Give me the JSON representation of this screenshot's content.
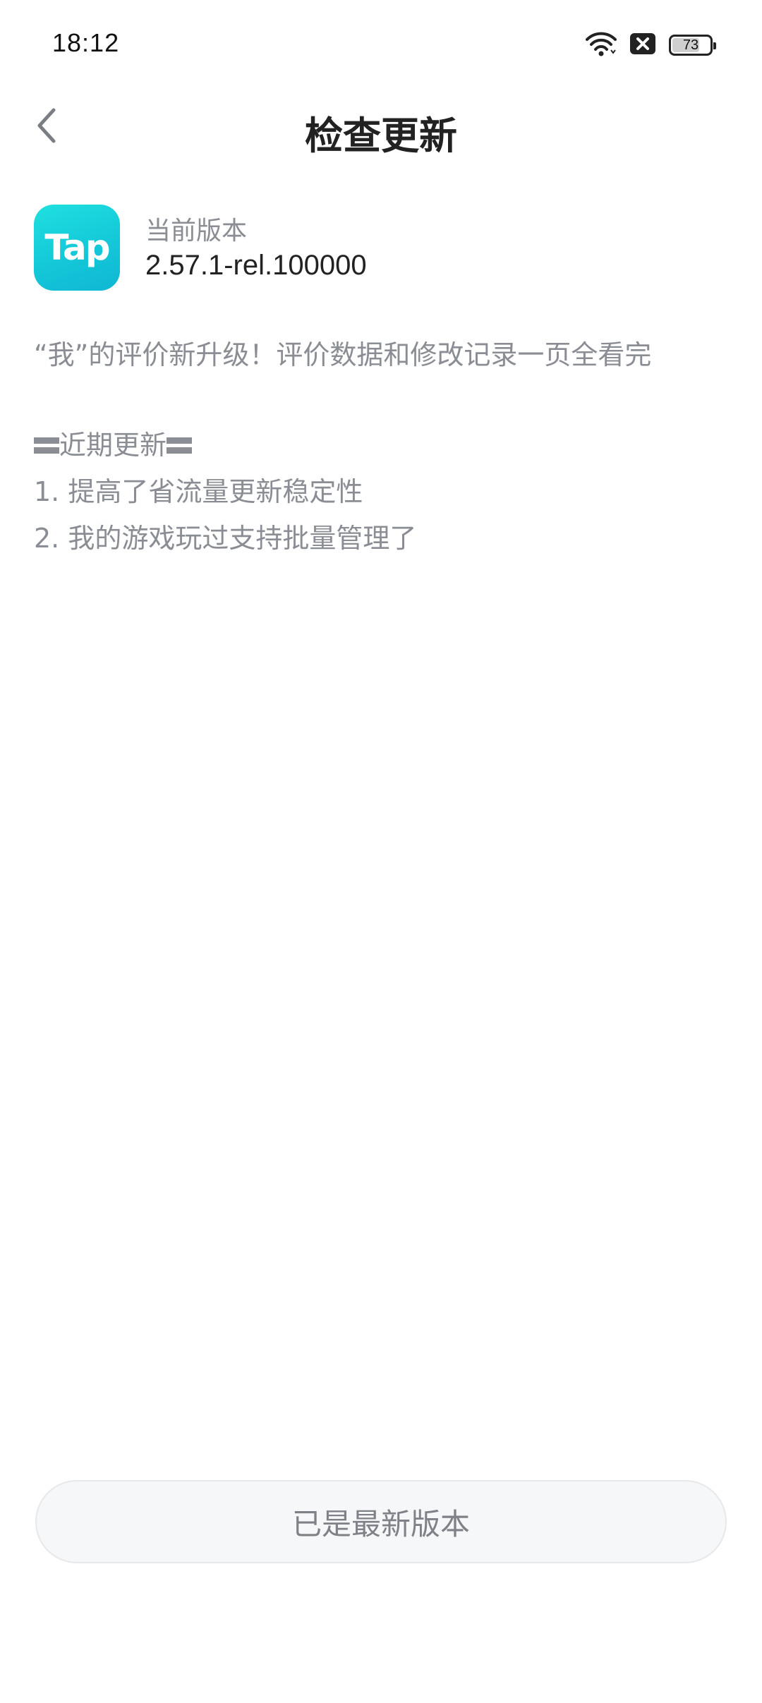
{
  "status_bar": {
    "time": "18:12",
    "battery_level": "73",
    "icons": [
      "wifi-icon",
      "notification-x-icon",
      "battery-icon"
    ]
  },
  "nav": {
    "title": "检查更新",
    "back_icon": "chevron-left-icon"
  },
  "app": {
    "logo_text": "Tap",
    "version_label": "当前版本",
    "version_value": "2.57.1-rel.100000"
  },
  "release_notes": {
    "headline": "“我”的评价新升级！评价数据和修改记录一页全看完",
    "section_title": "近期更新",
    "items": [
      "1. 提高了省流量更新稳定性",
      "2. 我的游戏玩过支持批量管理了"
    ]
  },
  "button": {
    "label": "已是最新版本"
  },
  "colors": {
    "accent": "#14C8D8",
    "text_primary": "#222222",
    "text_secondary": "#8A8D93",
    "button_bg": "#F6F7F8"
  }
}
